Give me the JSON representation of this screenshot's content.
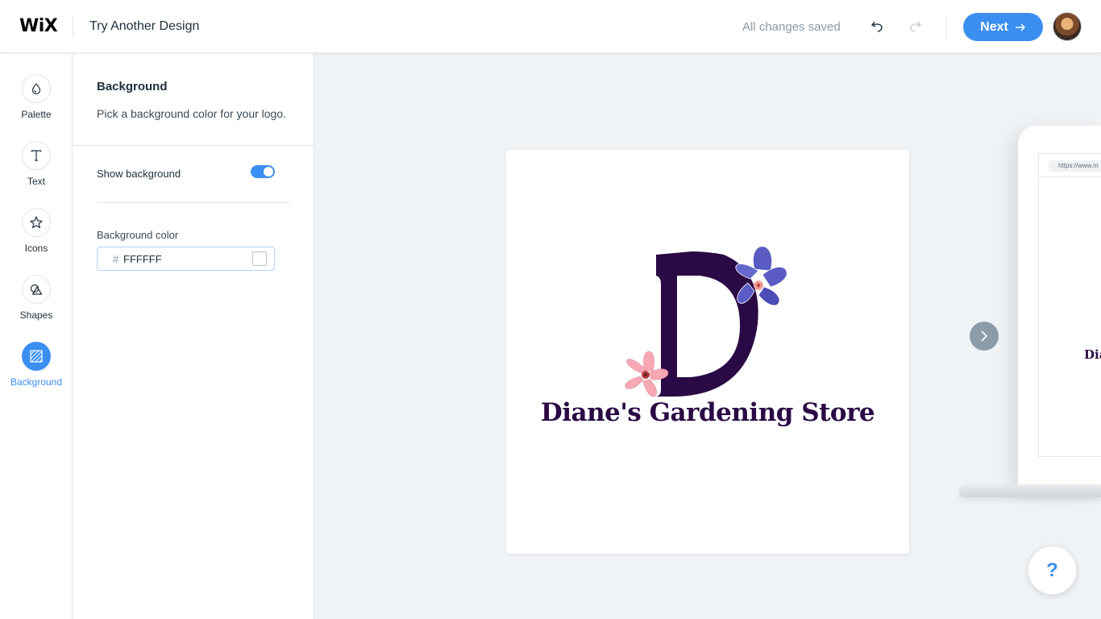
{
  "header": {
    "brand": "WiX",
    "title": "Try Another Design",
    "status": "All changes saved",
    "next_label": "Next"
  },
  "rail": {
    "items": [
      {
        "label": "Palette",
        "icon": "palette-icon",
        "active": false
      },
      {
        "label": "Text",
        "icon": "text-icon",
        "active": false
      },
      {
        "label": "Icons",
        "icon": "star-icon",
        "active": false
      },
      {
        "label": "Shapes",
        "icon": "shapes-icon",
        "active": false
      },
      {
        "label": "Background",
        "icon": "background-icon",
        "active": true
      }
    ]
  },
  "panel": {
    "title": "Background",
    "description": "Pick a background color for your logo.",
    "show_background_label": "Show background",
    "show_background": true,
    "background_color_label": "Background color",
    "hash": "#",
    "background_color_value": "FFFFFF"
  },
  "canvas": {
    "logo_text": "Diane's Gardening Store",
    "laptop_url": "https://www.m",
    "laptop_brand": "Dia"
  },
  "help": {
    "label": "?"
  },
  "colors": {
    "accent": "#3b8ff0",
    "logo_text": "#2a0a45",
    "flower_pink": "#f8a8b4",
    "flower_blue": "#5a5cc4"
  }
}
